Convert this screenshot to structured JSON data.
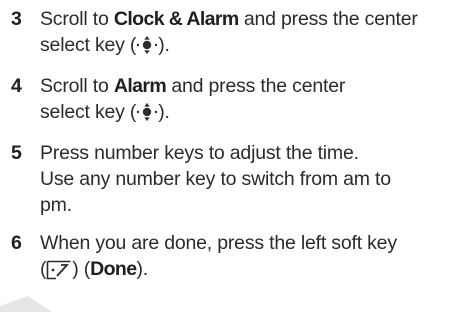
{
  "steps": [
    {
      "number": "3",
      "before": "Scroll to ",
      "keyword": "Clock & Alarm",
      "middle": " and press the center",
      "line2": "select key (",
      "icon": "center-select-key-icon",
      "after": ")."
    },
    {
      "number": "4",
      "before": "Scroll to ",
      "keyword": "Alarm",
      "middle": " and press the center",
      "line2": "select key (",
      "icon": "center-select-key-icon",
      "after": ")."
    },
    {
      "number": "5",
      "line1": "Press number keys to adjust the time.",
      "line2": "Use any number key to switch from am to",
      "line3": "pm."
    },
    {
      "number": "6",
      "line1": "When you are done, press the left soft key",
      "open_paren": "(",
      "icon": "left-soft-key-icon",
      "mid": ") (",
      "keyword": "Done",
      "after": ")."
    }
  ]
}
